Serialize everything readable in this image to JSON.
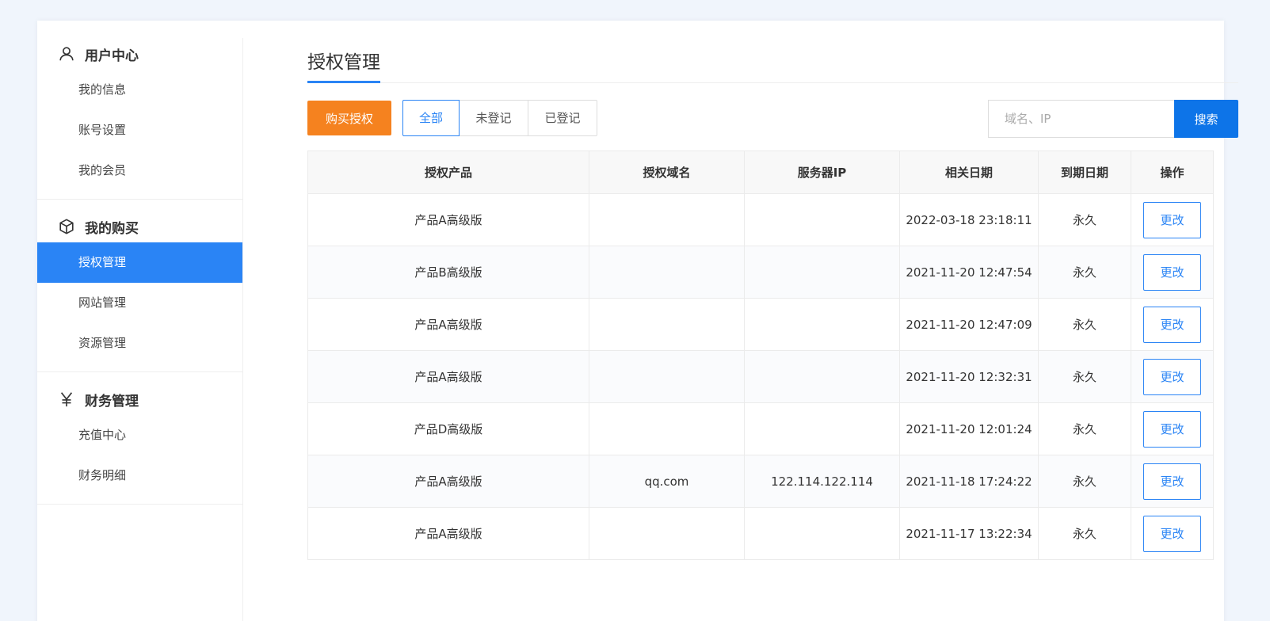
{
  "sidebar": {
    "groups": [
      {
        "title": "用户中心",
        "icon": "user-icon",
        "items": [
          {
            "label": "我的信息"
          },
          {
            "label": "账号设置"
          },
          {
            "label": "我的会员"
          }
        ]
      },
      {
        "title": "我的购买",
        "icon": "box-icon",
        "items": [
          {
            "label": "授权管理",
            "active": true
          },
          {
            "label": "网站管理"
          },
          {
            "label": "资源管理"
          }
        ]
      },
      {
        "title": "财务管理",
        "icon": "yen-icon",
        "items": [
          {
            "label": "充值中心"
          },
          {
            "label": "财务明细"
          }
        ]
      }
    ]
  },
  "page": {
    "title": "授权管理"
  },
  "toolbar": {
    "buy_label": "购买授权",
    "filters": [
      {
        "label": "全部",
        "active": true
      },
      {
        "label": "未登记"
      },
      {
        "label": "已登记"
      }
    ],
    "search_placeholder": "域名、IP",
    "search_label": "搜索"
  },
  "table": {
    "headers": [
      "授权产品",
      "授权域名",
      "服务器IP",
      "相关日期",
      "到期日期",
      "操作"
    ],
    "rows": [
      {
        "product": "产品A高级版",
        "domain": "",
        "ip": "",
        "date": "2022-03-18 23:18:11",
        "expire": "永久",
        "action": "更改"
      },
      {
        "product": "产品B高级版",
        "domain": "",
        "ip": "",
        "date": "2021-11-20 12:47:54",
        "expire": "永久",
        "action": "更改"
      },
      {
        "product": "产品A高级版",
        "domain": "",
        "ip": "",
        "date": "2021-11-20 12:47:09",
        "expire": "永久",
        "action": "更改"
      },
      {
        "product": "产品A高级版",
        "domain": "",
        "ip": "",
        "date": "2021-11-20 12:32:31",
        "expire": "永久",
        "action": "更改"
      },
      {
        "product": "产品D高级版",
        "domain": "",
        "ip": "",
        "date": "2021-11-20 12:01:24",
        "expire": "永久",
        "action": "更改"
      },
      {
        "product": "产品A高级版",
        "domain": "qq.com",
        "ip": "122.114.122.114",
        "date": "2021-11-18 17:24:22",
        "expire": "永久",
        "action": "更改"
      },
      {
        "product": "产品A高级版",
        "domain": "",
        "ip": "",
        "date": "2021-11-17 13:22:34",
        "expire": "永久",
        "action": "更改"
      }
    ]
  },
  "colors": {
    "accent": "#2a84f5",
    "buy": "#f5821f",
    "search": "#0d74e8",
    "background": "#f0f5fc"
  }
}
